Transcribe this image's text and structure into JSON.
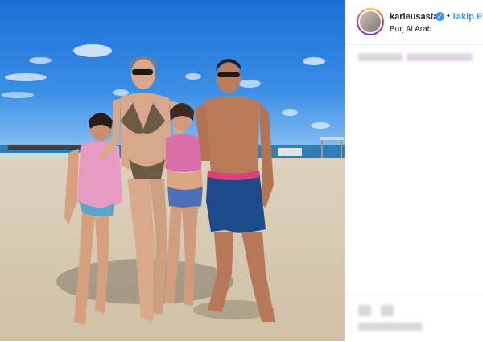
{
  "post": {
    "username": "karleusastar",
    "follow_separator": "•",
    "follow_label": "Takip Et",
    "location": "Burj Al Arab",
    "verified_glyph": "✓"
  },
  "colors": {
    "accent": "#3897f0",
    "text": "#262626",
    "border": "#efefef"
  },
  "icons": {
    "verified": "verified-badge-icon"
  }
}
